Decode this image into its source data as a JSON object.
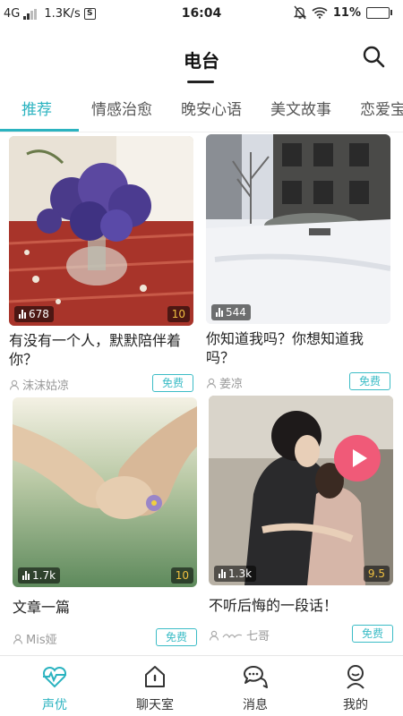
{
  "status_bar": {
    "network": "4G",
    "speed": "1.3K/s",
    "speed_icon": "S",
    "time": "16:04",
    "battery": "11%",
    "battery_level": 0.11,
    "icons": [
      "mute-icon",
      "wifi-icon",
      "battery-icon"
    ]
  },
  "header": {
    "title": "电台",
    "search_icon": "search-icon"
  },
  "tabs": [
    {
      "label": "推荐",
      "active": true
    },
    {
      "label": "情感治愈",
      "active": false
    },
    {
      "label": "晚安心语",
      "active": false
    },
    {
      "label": "美文故事",
      "active": false
    },
    {
      "label": "恋爱宝",
      "active": false
    }
  ],
  "cards": [
    {
      "title": "有没有一个人，默默陪伴着你？",
      "plays": "678",
      "count": "10",
      "author": "沫沫姑凉",
      "price": "免费"
    },
    {
      "title": "你知道我吗？你想知道我吗？",
      "plays": "544",
      "count": "",
      "author": "姜凉",
      "price": "免费"
    },
    {
      "title": "文章一篇",
      "plays": "1.7k",
      "count": "10",
      "author": "Mis娅",
      "price": "免费"
    },
    {
      "title": "不听后悔的一段话！",
      "plays": "1.3k",
      "count": "9.5",
      "author": "七哥",
      "price": "免费"
    }
  ],
  "bottom_nav": [
    {
      "label": "声优",
      "icon": "heartbeat-icon",
      "active": true
    },
    {
      "label": "聊天室",
      "icon": "home-icon",
      "active": false
    },
    {
      "label": "消息",
      "icon": "chat-icon",
      "active": false
    },
    {
      "label": "我的",
      "icon": "user-icon",
      "active": false
    }
  ],
  "colors": {
    "accent": "#2bb3c0",
    "play_button": "#f05a78",
    "badge_count": "#f0c040"
  }
}
